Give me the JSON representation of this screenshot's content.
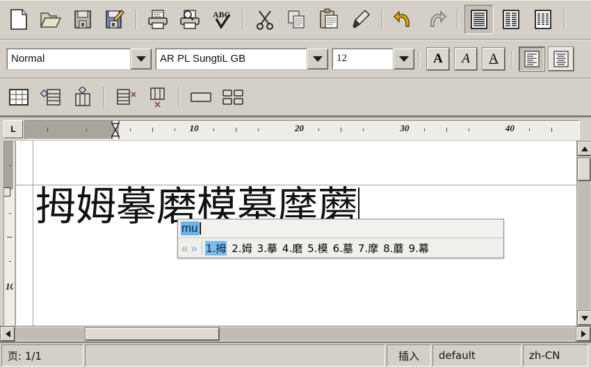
{
  "toolbars": {
    "standard": [
      {
        "name": "new-document",
        "icon": "page-icon",
        "label": "New",
        "pressed": false
      },
      {
        "name": "open-document",
        "icon": "folder-open-icon",
        "label": "Open",
        "pressed": false
      },
      {
        "name": "save-document",
        "icon": "floppy-disk-icon",
        "label": "Save",
        "pressed": false
      },
      {
        "name": "save-as-document",
        "icon": "floppy-pencil-icon",
        "label": "Save As",
        "pressed": false
      },
      {
        "name": "separator",
        "icon": "separator",
        "label": "",
        "pressed": false
      },
      {
        "name": "print",
        "icon": "printer-icon",
        "label": "Print",
        "pressed": false
      },
      {
        "name": "print-preview",
        "icon": "printer-preview-icon",
        "label": "Print Preview",
        "pressed": false
      },
      {
        "name": "spellcheck",
        "icon": "abc-check-icon",
        "label": "Spelling",
        "pressed": false
      },
      {
        "name": "separator",
        "icon": "separator",
        "label": "",
        "pressed": false
      },
      {
        "name": "cut",
        "icon": "scissors-icon",
        "label": "Cut",
        "pressed": false
      },
      {
        "name": "copy",
        "icon": "copy-icon",
        "label": "Copy",
        "pressed": false
      },
      {
        "name": "paste",
        "icon": "clipboard-icon",
        "label": "Paste",
        "pressed": false
      },
      {
        "name": "format-paintbrush",
        "icon": "paintbrush-icon",
        "label": "Format Paintbrush",
        "pressed": false
      },
      {
        "name": "separator",
        "icon": "separator",
        "label": "",
        "pressed": false
      },
      {
        "name": "undo",
        "icon": "undo-arrow-icon",
        "label": "Undo",
        "pressed": false
      },
      {
        "name": "redo",
        "icon": "redo-arrow-icon",
        "label": "Redo",
        "pressed": false
      },
      {
        "name": "separator",
        "icon": "separator",
        "label": "",
        "pressed": false
      },
      {
        "name": "view-normal",
        "icon": "lines-page-icon",
        "label": "Normal Layout",
        "pressed": true
      },
      {
        "name": "view-two-column",
        "icon": "two-column-page-icon",
        "label": "Two Column Layout",
        "pressed": false
      },
      {
        "name": "view-three-column",
        "icon": "three-column-page-icon",
        "label": "Three Column Layout",
        "pressed": false
      },
      {
        "name": "separator",
        "icon": "separator",
        "label": "",
        "pressed": false
      }
    ],
    "formatting": {
      "style": {
        "value": "Normal",
        "placeholder": "Paragraph Style"
      },
      "font": {
        "value": "AR PL SungtiL GB",
        "placeholder": "Font Name"
      },
      "size": {
        "value": "12",
        "placeholder": "Font Size"
      },
      "bold_label": "A",
      "italic_label": "A",
      "underline_label": "A",
      "align_left": {
        "name": "align-left-button",
        "pressed": true
      },
      "align_center": {
        "name": "align-center-button",
        "pressed": false
      }
    },
    "table": [
      {
        "name": "insert-table",
        "icon": "table-grid-icon",
        "label": "Insert Table"
      },
      {
        "name": "insert-row",
        "icon": "insert-row-icon",
        "label": "Insert Row"
      },
      {
        "name": "insert-column",
        "icon": "insert-column-icon",
        "label": "Insert Column"
      },
      {
        "name": "separator",
        "icon": "separator",
        "label": ""
      },
      {
        "name": "delete-row",
        "icon": "delete-row-icon",
        "label": "Delete Row"
      },
      {
        "name": "delete-column",
        "icon": "delete-column-icon",
        "label": "Delete Column"
      },
      {
        "name": "separator",
        "icon": "separator",
        "label": ""
      },
      {
        "name": "merge-cells",
        "icon": "merge-cells-icon",
        "label": "Merge Cells"
      },
      {
        "name": "split-cells",
        "icon": "split-cells-icon",
        "label": "Split Cells"
      }
    ]
  },
  "ruler": {
    "tab_selector_label": "L",
    "horizontal_numbers": [
      {
        "label": "10",
        "pos_pct": 30.5
      },
      {
        "label": "20",
        "pos_pct": 49.5
      },
      {
        "label": "30",
        "pos_pct": 68.5
      },
      {
        "label": "40",
        "pos_pct": 87.5
      }
    ],
    "vertical_numbers": [
      {
        "label": "10",
        "pos_pct": 80
      }
    ]
  },
  "document": {
    "text": "拇姆摹磨模墓摩蘑",
    "font_display": "AR PL SungtiL GB"
  },
  "ime": {
    "input_value": "mu",
    "prev_page_label": "«",
    "next_page_label": "»",
    "candidates": [
      {
        "index": "1.",
        "char": "拇",
        "selected": true
      },
      {
        "index": "2.",
        "char": "姆",
        "selected": false
      },
      {
        "index": "3.",
        "char": "摹",
        "selected": false
      },
      {
        "index": "4.",
        "char": "磨",
        "selected": false
      },
      {
        "index": "5.",
        "char": "模",
        "selected": false
      },
      {
        "index": "6.",
        "char": "墓",
        "selected": false
      },
      {
        "index": "7.",
        "char": "摩",
        "selected": false
      },
      {
        "index": "8.",
        "char": "蘑",
        "selected": false
      },
      {
        "index": "9.",
        "char": "幕",
        "selected": false
      }
    ]
  },
  "status": {
    "page": "页: 1/1",
    "blank": "",
    "insert_mode": "插入",
    "style": "default",
    "language": "zh-CN"
  },
  "colors": {
    "ime_highlight": "#79bdf0",
    "toolbar_bg": "#d4d0c8",
    "page_bg": "#ffffff",
    "ruler_bg": "#eeece6",
    "margin_shade": "#a9a59c"
  }
}
